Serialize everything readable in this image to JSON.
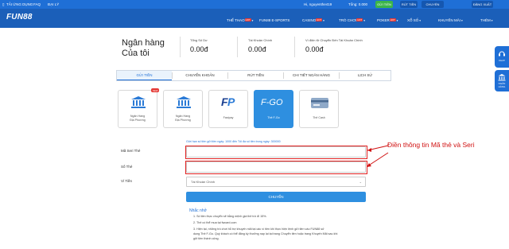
{
  "topbar": {
    "app_download": "TẢI ỨNG DỤNG",
    "faq": "FAQ",
    "agent": "ĐẠI LÝ",
    "greeting": "Hi, nguyenthe419",
    "balance": "Tổng: 0.000",
    "deposit_btn": "GỬI TIỀN",
    "withdraw_btn": "RÚT TIỀN",
    "transfer_btn": "CHUYỂN KHOẢN",
    "logout_btn": "ĐĂNG XUẤT"
  },
  "nav": {
    "logo": "FUN88",
    "items": [
      {
        "label": "THỂ THAO",
        "hot": "HOT"
      },
      {
        "label": "FUN88 E-SPORTS",
        "hot": ""
      },
      {
        "label": "CASINO",
        "hot": "HOT"
      },
      {
        "label": "TRÒ CHƠI",
        "hot": "HOT"
      },
      {
        "label": "POKER",
        "hot": "HOT"
      },
      {
        "label": "XỔ SỐ",
        "hot": ""
      },
      {
        "label": "KHUYẾN MÃI",
        "hot": ""
      },
      {
        "label": "THÊM",
        "hot": ""
      }
    ]
  },
  "account": {
    "title_line1": "Ngân hàng",
    "title_line2": "Của tôi",
    "stats": [
      {
        "label": "Tổng Số Dư",
        "value": "0.00đ"
      },
      {
        "label": "Tài Khoản Chính",
        "value": "0.00đ"
      },
      {
        "label": "Ví điện tử Chuyển Đến Tài Khoản Chính",
        "value": "0.00đ"
      }
    ]
  },
  "tabs": [
    "GỬI TIỀN",
    "CHUYỂN KHOẢN",
    "RÚT TIỀN",
    "CHI TIẾT NGÂN HÀNG",
    "LỊCH SỬ"
  ],
  "methods": [
    {
      "label1": "Ngân Hàng",
      "label2": "Địa Phương",
      "badge": "NEW",
      "icon": "bank-icon"
    },
    {
      "label1": "Ngân Hàng",
      "label2": "Địa Phương",
      "badge": "",
      "icon": "bank-icon"
    },
    {
      "label1": "Fastpay",
      "label2": "",
      "badge": "",
      "icon": "fastpay-logo"
    },
    {
      "label1": "Thẻ F-Go",
      "label2": "",
      "badge": "",
      "icon": "fgo-logo"
    },
    {
      "label1": "Thẻ Cash",
      "label2": "",
      "badge": "",
      "icon": "card-icon"
    }
  ],
  "form": {
    "hint": "Giới hạn số tiền gửi tiền ngày: 1000 đến Tối đa số tiền trong ngày: 300000",
    "serial_label": "Mã Seri Thẻ",
    "card_label": "Số Thẻ",
    "wallet_label": "Ví Tiền",
    "wallet_value": "Tài Khoản Chính",
    "submit": "CHUYỂN"
  },
  "annotation": "Điền thông tin Mã thẻ và Seri",
  "notes": {
    "title": "Nhắc nhở",
    "lines": [
      "1. Số tiền thực chuyển sẽ bằng mệnh giá thẻ trừ đi 15%.",
      "2. Thẻ có thể mua tại fwcard.com",
      "3. Hiện tại, những trò chơi hỗ trợ khuyến mãi tại các ví tiền khi thực hiện lệnh gửi tiền vào FUN88 sử",
      "dụng Thẻ F-Go. Quý khách có thể đăng ký thưởng nạp lại tại trang Chuyển tiền hoặc trang Khuyến Mãi sau khi",
      "gửi tiền thành công."
    ]
  },
  "side_widgets": [
    {
      "label": "CHAT"
    },
    {
      "label": "NGÂN HÀNG"
    }
  ],
  "colors": {
    "brand_blue": "#1f6fd6",
    "annotation_red": "#d01010"
  }
}
